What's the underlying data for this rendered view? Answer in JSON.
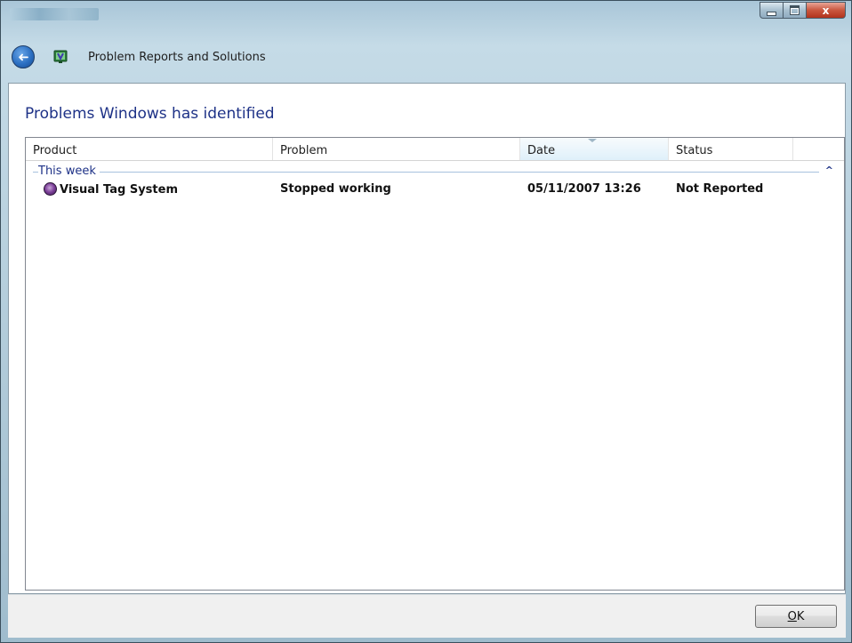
{
  "window": {
    "title": "Problem Reports and Solutions",
    "buttons": {
      "minimize": "minimize-icon",
      "maximize": "maximize-icon",
      "close_glyph": "x"
    }
  },
  "nav": {
    "back_icon": "back-arrow-icon",
    "back_glyph": "➜"
  },
  "main": {
    "heading": "Problems Windows has identified",
    "columns": [
      {
        "label": "Product"
      },
      {
        "label": "Problem"
      },
      {
        "label": "Date",
        "sorted": true
      },
      {
        "label": "Status"
      }
    ],
    "group": {
      "label": "This week",
      "collapse_glyph": "^"
    },
    "rows": [
      {
        "product": "Visual Tag System",
        "problem": "Stopped working",
        "date": "05/11/2007 13:26",
        "status": "Not Reported"
      }
    ]
  },
  "footer": {
    "ok_accel": "O",
    "ok_rest": "K"
  },
  "colors": {
    "heading": "#1e3287",
    "group_line": "#a7c2de",
    "sorted_header_bg": "#dff0fa",
    "close_button": "#c9563e"
  }
}
